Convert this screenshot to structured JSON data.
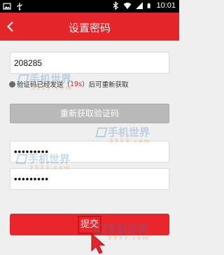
{
  "status_bar": {
    "time": "10:01",
    "left_icons": [
      "image-icon",
      "usb-icon"
    ],
    "right_icons": [
      "bluetooth-icon",
      "wifi-icon",
      "signal-icon",
      "battery-icon"
    ]
  },
  "header": {
    "back_icon": "chevron-left-icon",
    "title": "设置密码"
  },
  "form": {
    "verification_code_value": "208285",
    "sent_notice": {
      "prefix": "验证码已经发送（",
      "countdown": "19s",
      "suffix": "）后可重新获取"
    },
    "resend_label": "重新获取验证码",
    "password_value": "•••••••••",
    "confirm_password_value": "•••••••••",
    "submit_label": "提交"
  },
  "watermark": {
    "text": "手机世界",
    "sub": "3533.com"
  },
  "colors": {
    "brand_red": "#e3262a",
    "disabled_gray": "#b9b9b9",
    "background": "#efefef"
  }
}
